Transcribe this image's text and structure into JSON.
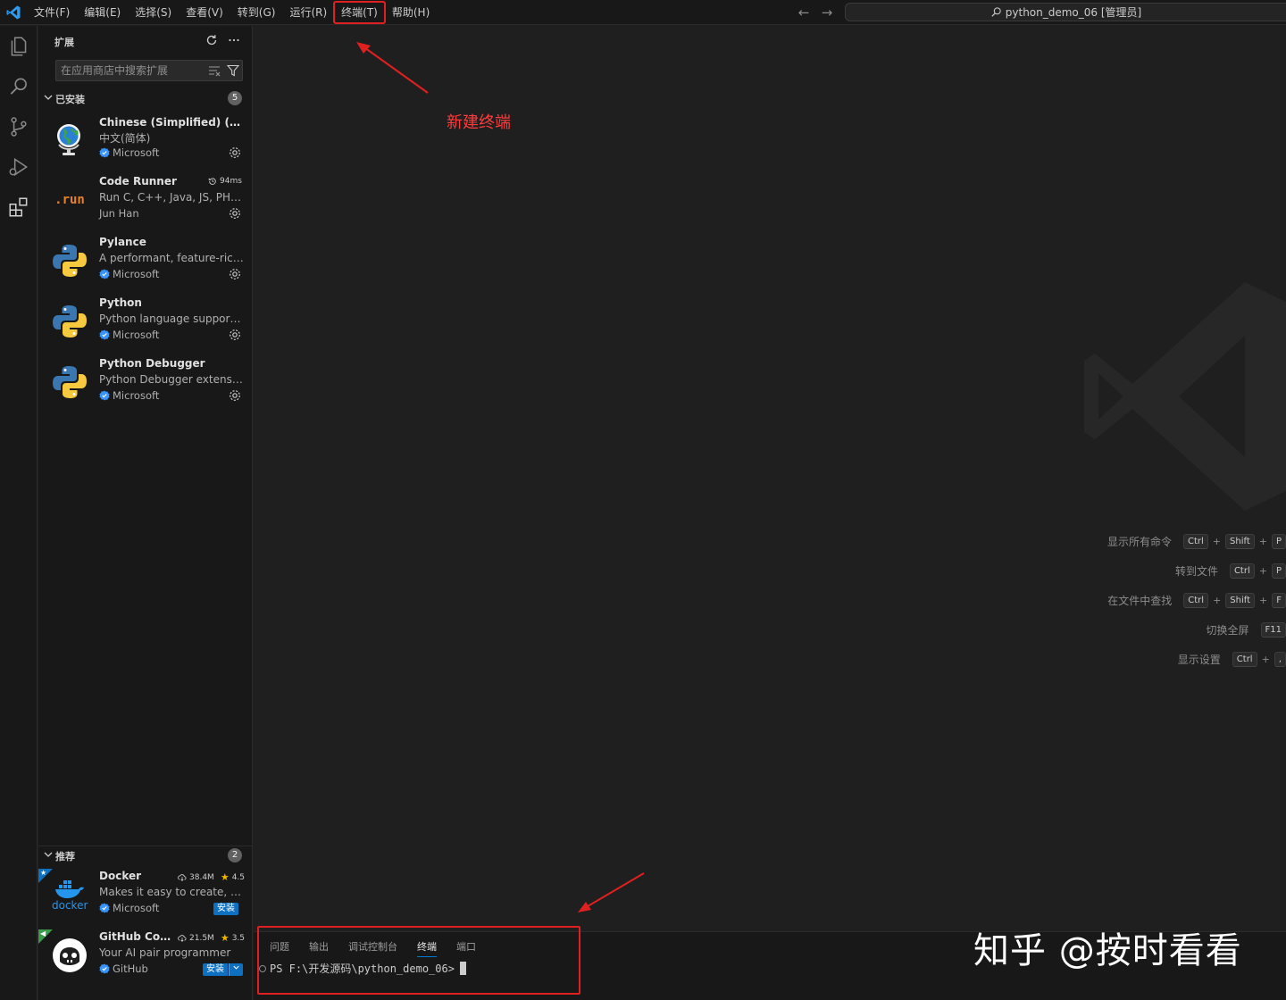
{
  "menu": {
    "items": [
      {
        "label": "文件(F)",
        "highlighted": false
      },
      {
        "label": "编辑(E)",
        "highlighted": false
      },
      {
        "label": "选择(S)",
        "highlighted": false
      },
      {
        "label": "查看(V)",
        "highlighted": false
      },
      {
        "label": "转到(G)",
        "highlighted": false
      },
      {
        "label": "运行(R)",
        "highlighted": false
      },
      {
        "label": "终端(T)",
        "highlighted": true
      },
      {
        "label": "帮助(H)",
        "highlighted": false
      }
    ],
    "back_icon": "arrow-left-icon",
    "forward_icon": "arrow-right-icon"
  },
  "command_center": {
    "label": "python_demo_06 [管理员]",
    "icon": "search-icon"
  },
  "activity_bar": {
    "icons": [
      "explorer-icon",
      "search-icon",
      "source-control-icon",
      "run-debug-icon",
      "extensions-icon"
    ]
  },
  "sidebar": {
    "title": "扩展",
    "refresh_icon": "refresh-icon",
    "more_icon": "more-icon",
    "search": {
      "placeholder": "在应用商店中搜索扩展",
      "value": ""
    },
    "clear_icon": "clear-filter-icon",
    "filter_icon": "filter-icon",
    "installed": {
      "title": "已安装",
      "count": "5",
      "items": [
        {
          "name": "Chinese (Simplified) (简体...",
          "description": "中文(简体)",
          "publisher": "Microsoft",
          "verified": true,
          "icon": "globe-icon"
        },
        {
          "name": "Code Runner",
          "description": "Run C, C++, Java, JS, PHP, P...",
          "publisher": "Jun Han",
          "verified": false,
          "icon": "run-logo-icon",
          "icon_text": ".run",
          "activation_time": "94ms",
          "timer_icon": "history-icon"
        },
        {
          "name": "Pylance",
          "description": "A performant, feature-rich l...",
          "publisher": "Microsoft",
          "verified": true,
          "icon": "python-logo-icon"
        },
        {
          "name": "Python",
          "description": "Python language support wi...",
          "publisher": "Microsoft",
          "verified": true,
          "icon": "python-logo-icon"
        },
        {
          "name": "Python Debugger",
          "description": "Python Debugger extension...",
          "publisher": "Microsoft",
          "verified": true,
          "icon": "python-logo-icon"
        }
      ]
    },
    "recommended": {
      "title": "推荐",
      "count": "2",
      "items": [
        {
          "name": "Docker",
          "description": "Makes it easy to create, ma...",
          "publisher": "Microsoft",
          "verified": true,
          "icon": "docker-logo-icon",
          "icon_text": "docker",
          "downloads": "38.4M",
          "rating": "4.5",
          "install_label": "安装"
        },
        {
          "name": "GitHub Cop...",
          "description": "Your AI pair programmer",
          "publisher": "GitHub",
          "verified": true,
          "icon": "copilot-logo-icon",
          "downloads": "21.5M",
          "rating": "3.5",
          "install_label": "安装"
        }
      ]
    }
  },
  "editor": {
    "watermark_icon": "vscode-logo-icon",
    "annotation": "新建终端",
    "shortcuts": [
      {
        "label": "显示所有命令",
        "keys": [
          "Ctrl",
          "Shift",
          "P"
        ]
      },
      {
        "label": "转到文件",
        "keys": [
          "Ctrl",
          "P"
        ]
      },
      {
        "label": "在文件中查找",
        "keys": [
          "Ctrl",
          "Shift",
          "F"
        ]
      },
      {
        "label": "切换全屏",
        "keys": [
          "F11"
        ]
      },
      {
        "label": "显示设置",
        "keys": [
          "Ctrl",
          ","
        ]
      }
    ]
  },
  "panel": {
    "tabs": [
      {
        "label": "问题",
        "active": false
      },
      {
        "label": "输出",
        "active": false
      },
      {
        "label": "调试控制台",
        "active": false
      },
      {
        "label": "终端",
        "active": true
      },
      {
        "label": "端口",
        "active": false
      }
    ],
    "terminal_prompt": "PS F:\\开发源码\\python_demo_06>"
  },
  "watermark": {
    "text": "知乎 @按时看看"
  },
  "colors": {
    "accent": "#0078d4",
    "annotation_red": "#e02020",
    "install_blue": "#0e70c0",
    "background": "#1f1f1f"
  }
}
